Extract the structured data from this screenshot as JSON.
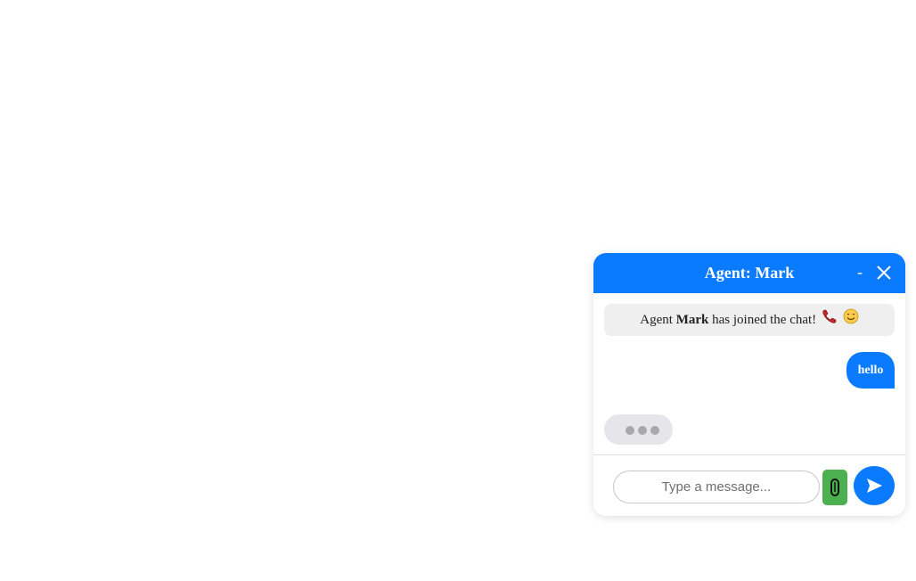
{
  "chat": {
    "header": {
      "title": "Agent: Mark",
      "minimize_label": "-",
      "close_icon": "close-icon"
    },
    "system_message": {
      "prefix": "Agent ",
      "agent_name": "Mark",
      "suffix": " has joined the chat!",
      "icons": [
        "phone-icon",
        "smile-icon"
      ]
    },
    "messages": [
      {
        "from": "user",
        "text": "hello"
      }
    ],
    "typing_indicator": {
      "icon": "typing-dots-icon"
    },
    "composer": {
      "placeholder": "Type a message...",
      "value": "",
      "attach_icon": "paperclip-icon",
      "send_icon": "send-icon"
    }
  },
  "colors": {
    "accent": "#0a7bff",
    "attach": "#4caf50",
    "system_bg": "#efefef",
    "typing_bg": "#e5e5ea"
  }
}
